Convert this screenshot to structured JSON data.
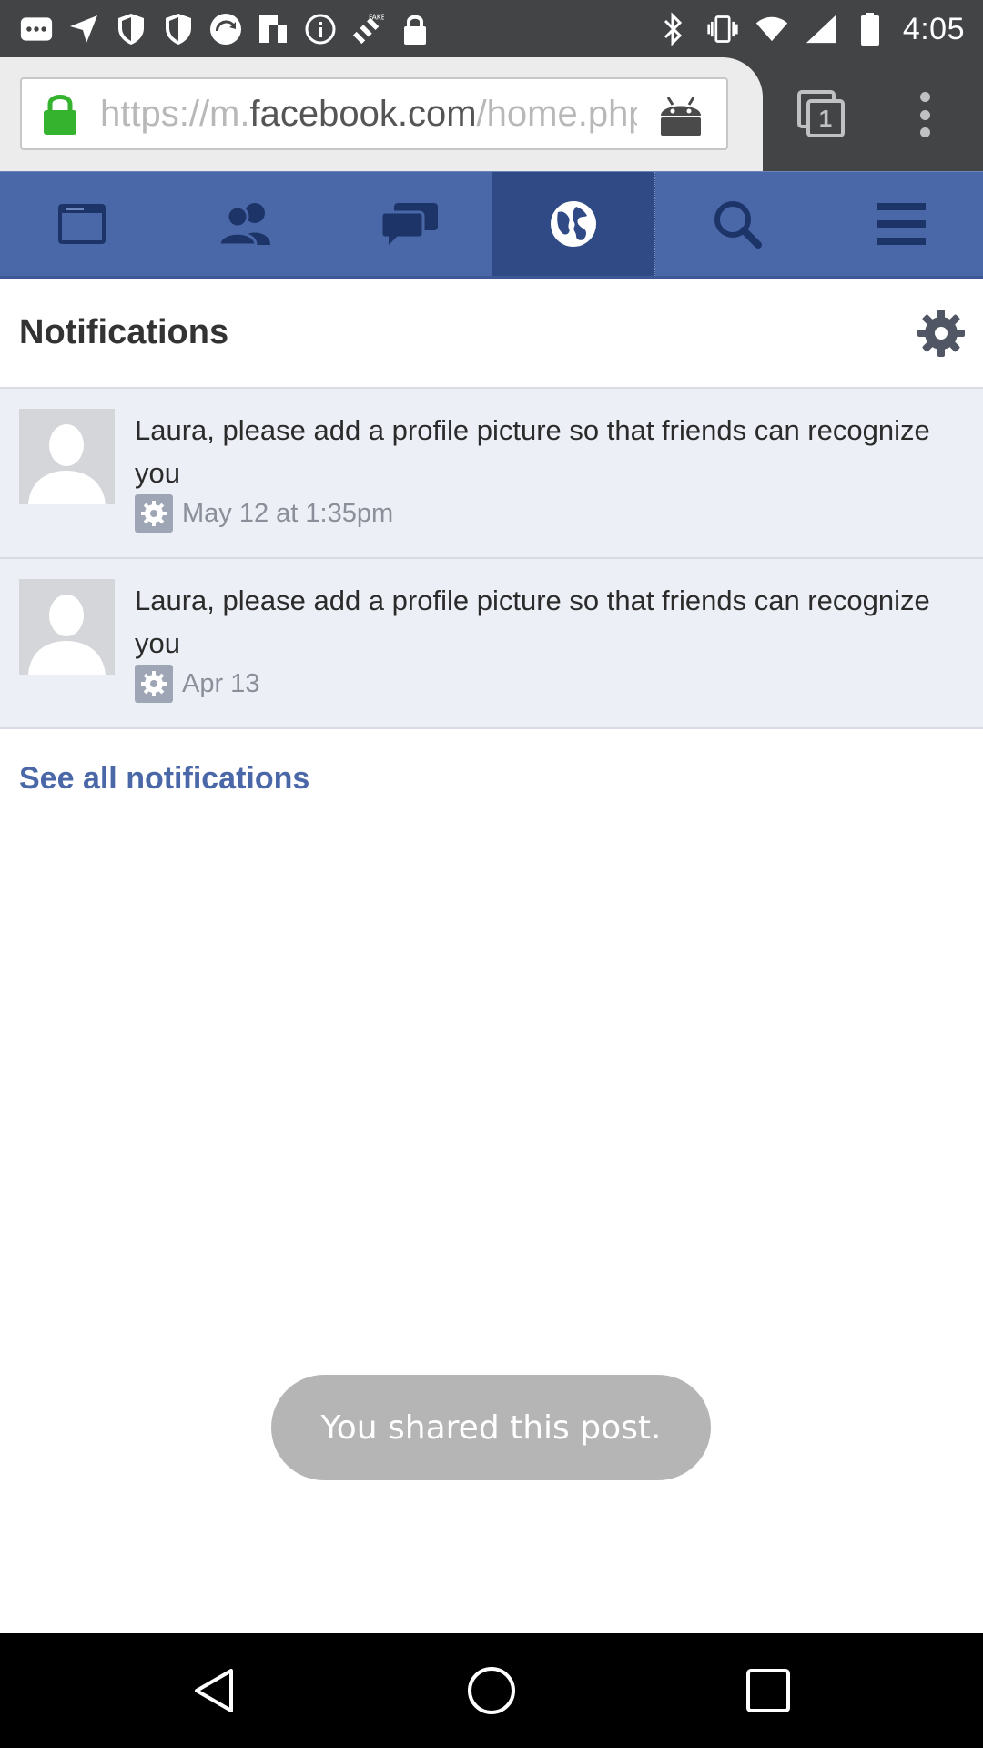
{
  "status_bar": {
    "time": "4:05",
    "icons": [
      "more-notifications-icon",
      "location-arrow-icon",
      "shield-icon",
      "shield-icon",
      "sync-icon",
      "flipboard-icon",
      "info-icon",
      "fake-gps-icon",
      "lock-icon",
      "bluetooth-icon",
      "vibrate-icon",
      "wifi-icon",
      "signal-icon",
      "battery-icon"
    ]
  },
  "browser": {
    "url_scheme": "https://m.",
    "url_host": "facebook.com",
    "url_path": "/home.php",
    "tab_count": "1"
  },
  "fb_nav": {
    "items": [
      {
        "name": "news-feed",
        "icon": "news-feed-icon"
      },
      {
        "name": "friend-requests",
        "icon": "friends-icon"
      },
      {
        "name": "messages",
        "icon": "messages-icon"
      },
      {
        "name": "notifications",
        "icon": "globe-icon",
        "active": true
      },
      {
        "name": "search",
        "icon": "search-icon"
      },
      {
        "name": "menu",
        "icon": "hamburger-menu-icon"
      }
    ]
  },
  "notifications": {
    "title": "Notifications",
    "items": [
      {
        "message": "Laura, please add a profile picture so that friends can recognize you",
        "time": "May 12 at 1:35pm"
      },
      {
        "message": "Laura, please add a profile picture so that friends can recognize you",
        "time": "Apr 13"
      }
    ],
    "see_all": "See all notifications"
  },
  "toast": {
    "text": "You shared this post."
  },
  "colors": {
    "fb_blue": "#4a67a8",
    "fb_blue_active": "#2f4a85",
    "status_bar": "#424446",
    "notif_bg": "#eceff6"
  }
}
